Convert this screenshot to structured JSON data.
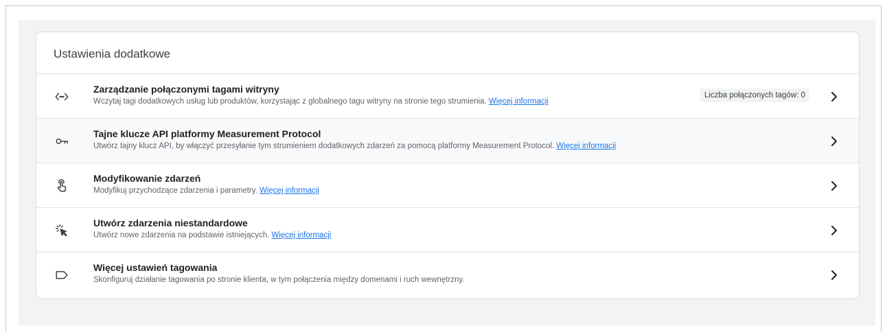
{
  "section": {
    "title": "Ustawienia dodatkowe"
  },
  "rows": [
    {
      "icon": "code-tag-icon",
      "title": "Zarządzanie połączonymi tagami witryny",
      "description": "Wczytaj tagi dodatkowych usług lub produktów, korzystając z globalnego tagu witryny na stronie tego strumienia.",
      "link": "Więcej informacji",
      "badge": "Liczba połączonych tagów: 0"
    },
    {
      "icon": "key-icon",
      "title": "Tajne klucze API platformy Measurement Protocol",
      "description": "Utwórz tajny klucz API, by włączyć przesyłanie tym strumieniem dodatkowych zdarzeń za pomocą platformy Measurement Protocol.",
      "link": "Więcej informacji"
    },
    {
      "icon": "touch-hand-icon",
      "title": "Modyfikowanie zdarzeń",
      "description": "Modyfikuj przychodzące zdarzenia i parametry.",
      "link": "Więcej informacji"
    },
    {
      "icon": "sparkle-cursor-icon",
      "title": "Utwórz zdarzenia niestandardowe",
      "description": "Utwórz nowe zdarzenia na podstawie istniejących.",
      "link": "Więcej informacji"
    },
    {
      "icon": "label-tag-icon",
      "title": "Więcej ustawień tagowania",
      "description": "Skonfiguruj działanie tagowania po stronie klienta, w tym połączenia między domenami i ruch wewnętrzny."
    }
  ],
  "colors": {
    "link": "#1a73e8",
    "panel_background": "#f1f3f4",
    "card_border": "#dadce0"
  }
}
